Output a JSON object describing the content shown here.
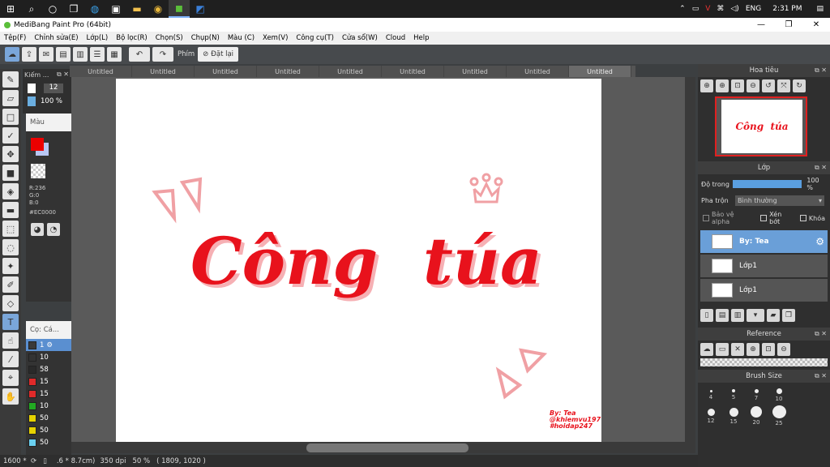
{
  "taskbar": {
    "icons": [
      "windows-icon",
      "search-icon",
      "cortana-icon",
      "taskview-icon",
      "edge-icon",
      "store-icon",
      "explorer-icon",
      "chrome-icon",
      "medibang-icon",
      "paint-icon"
    ],
    "tray": {
      "lang": "ENG",
      "time": "2:31 PM"
    }
  },
  "window": {
    "title": "MediBang Paint Pro (64bit)"
  },
  "menu": [
    "Tệp(F)",
    "Chỉnh sửa(E)",
    "Lớp(L)",
    "Bộ lọc(R)",
    "Chọn(S)",
    "Chụp(N)",
    "Màu (C)",
    "Xem(V)",
    "Công cụ(T)",
    "Cửa sổ(W)",
    "Cloud",
    "Help"
  ],
  "toolbar": {
    "phim_label": "Phím",
    "reset_label": "Đặt lại"
  },
  "brush": {
    "size": "12",
    "opacity": "100 %"
  },
  "color_panel": {
    "title": "Màu",
    "r": "R:236",
    "g": "G:0",
    "b": "B:0",
    "hex": "#EC0000"
  },
  "layer_list": {
    "title": "Cọ: Cá...",
    "rows": [
      {
        "num": "1",
        "color": "#3a3a3a"
      },
      {
        "num": "10",
        "color": "#333333"
      },
      {
        "num": "58",
        "color": "#2a2a2a"
      },
      {
        "num": "15",
        "color": "#e02a2a"
      },
      {
        "num": "15",
        "color": "#e02a2a"
      },
      {
        "num": "10",
        "color": "#22aa22"
      },
      {
        "num": "50",
        "color": "#e6d200"
      },
      {
        "num": "50",
        "color": "#e6d200"
      },
      {
        "num": "50",
        "color": "#6ad0f0"
      }
    ]
  },
  "tabs": [
    "Untitled",
    "Untitled",
    "Untitled",
    "Untitled",
    "Untitled",
    "Untitled",
    "Untitled",
    "Untitled",
    "Untitled"
  ],
  "canvas_art": {
    "title": "Công  túa",
    "signature": [
      "By: Tea",
      "@khiemvu197",
      "#hoidap247"
    ],
    "accent": "#e8121c"
  },
  "status": {
    "zoom": "1600 *",
    "size": ".6 * 8.7cm)",
    "dpi": "350 dpi",
    "percent": "50 %",
    "coords": "( 1809, 1020 )"
  },
  "navigator": {
    "title": "Hoa tiêu"
  },
  "layers": {
    "title": "Lớp",
    "opacity_label": "Độ trong",
    "opacity_value": "100 %",
    "opacity_fill": 1.0,
    "blend_label": "Pha trộn",
    "blend_value": "Bình thường",
    "protect_alpha": "Bảo vệ alpha",
    "clip": "Xén bớt",
    "lock": "Khóa",
    "items": [
      {
        "name": "By: Tea",
        "selected": true
      },
      {
        "name": "Lớp1",
        "selected": false
      },
      {
        "name": "Lớp1",
        "selected": false
      }
    ]
  },
  "reference": {
    "title": "Reference"
  },
  "brush_size": {
    "title": "Brush Size",
    "sizes": [
      "4",
      "5",
      "7",
      "10",
      "12",
      "15",
      "20",
      "25"
    ]
  }
}
